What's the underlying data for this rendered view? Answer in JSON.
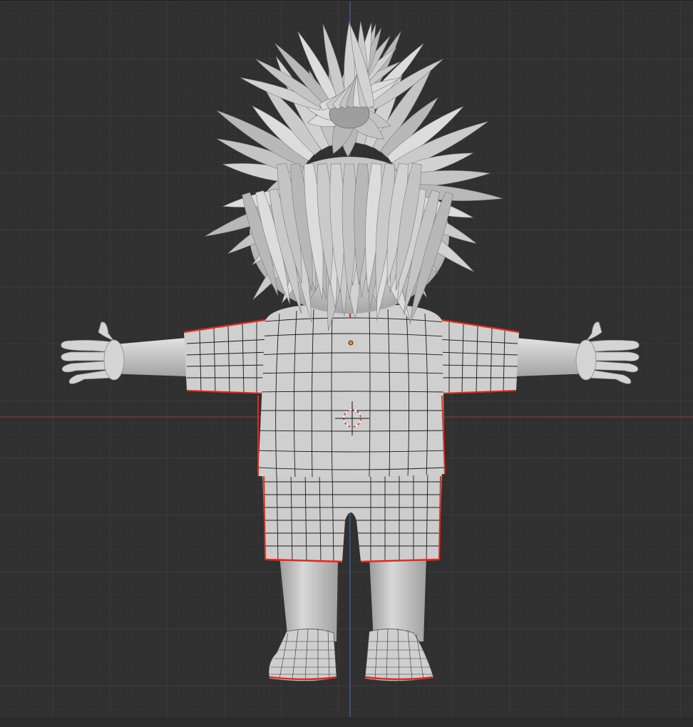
{
  "viewport": {
    "view_mode": "front-orthographic",
    "background_color": "#303030",
    "grid_minor_color": "#3a3a3a",
    "grid_major_color": "#474747",
    "x_axis_color": "#b3393a",
    "z_axis_color": "#3a68b8",
    "seam_color": "#e02a1e",
    "mesh_base_color": "#c9c9c9",
    "wire_color": "#1a1a1a",
    "origin_color": "#f08a1a",
    "cursor_color": "#e03a3a"
  },
  "model": {
    "name": "cartoon-character",
    "parts": [
      "hair",
      "head",
      "shirt",
      "arms",
      "hands",
      "shorts",
      "legs",
      "shoes"
    ],
    "has_uv_seams": true,
    "shading": "solid-grey"
  },
  "icons": {
    "origin": "origin-dot-icon",
    "cursor": "3d-cursor-icon"
  }
}
